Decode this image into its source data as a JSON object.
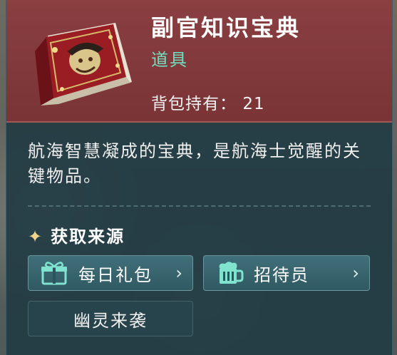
{
  "item": {
    "name": "副官知识宝典",
    "type": "道具",
    "owned_label": "背包持有：",
    "owned_count": "21",
    "description": "航海智慧凝成的宝典，是航海士觉醒的关键物品。"
  },
  "sources": {
    "title": "获取来源",
    "title_icon": "sparkle-icon",
    "buttons": [
      {
        "label": "每日礼包",
        "icon": "gift-icon",
        "has_arrow": true
      },
      {
        "label": "招待员",
        "icon": "beer-mug-icon",
        "has_arrow": true
      },
      {
        "label": "幽灵来袭",
        "icon": null,
        "has_arrow": false
      }
    ]
  },
  "colors": {
    "header_bg": "#8a3f41",
    "panel_bg": "#203a42",
    "type_text": "#6fe0c0",
    "icon_accent": "#7fe3d0"
  }
}
